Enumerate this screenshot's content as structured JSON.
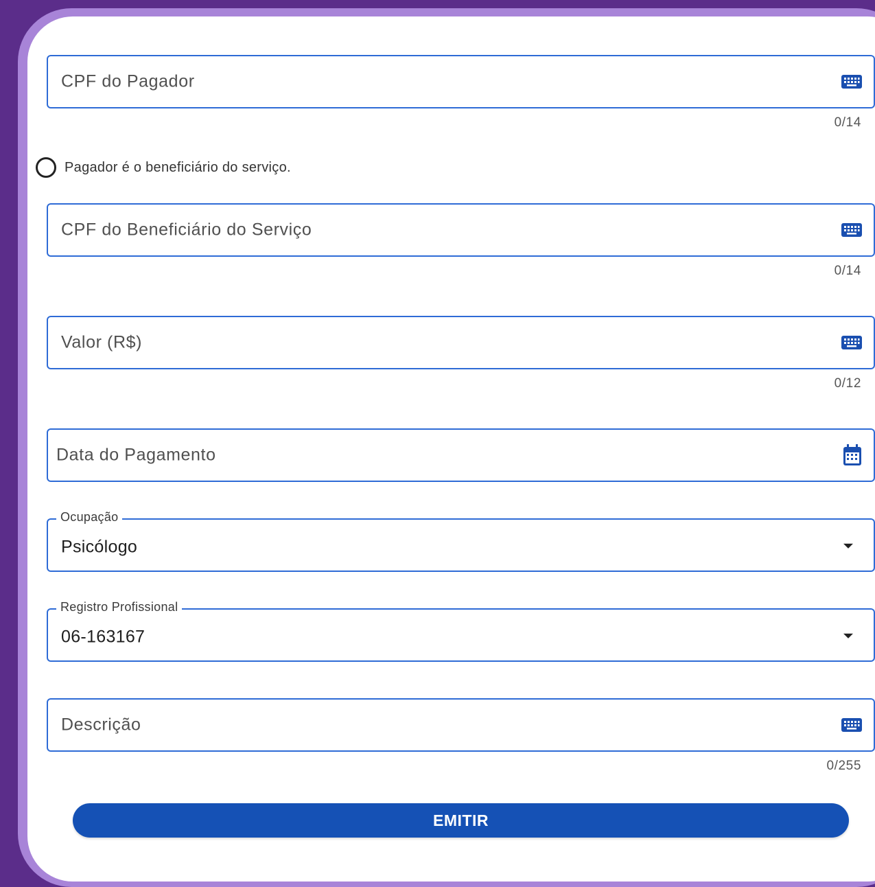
{
  "form": {
    "cpf_pagador": {
      "placeholder": "CPF do Pagador",
      "counter": "0/14",
      "icon": "keyboard-icon"
    },
    "radio_pagador_beneficiario": {
      "label": "Pagador é o beneficiário do serviço.",
      "checked": false
    },
    "cpf_beneficiario": {
      "placeholder": "CPF do Beneficiário do Serviço",
      "counter": "0/14",
      "icon": "keyboard-icon"
    },
    "valor": {
      "placeholder": "Valor (R$)",
      "counter": "0/12",
      "icon": "keyboard-icon"
    },
    "data_pagamento": {
      "placeholder": "Data do Pagamento",
      "icon": "calendar-icon"
    },
    "ocupacao": {
      "label": "Ocupação",
      "value": "Psicólogo",
      "icon": "dropdown-caret-icon"
    },
    "registro_profissional": {
      "label": "Registro Profissional",
      "value": "06-163167",
      "icon": "dropdown-caret-icon"
    },
    "descricao": {
      "placeholder": "Descrição",
      "counter": "0/255",
      "icon": "keyboard-icon"
    },
    "submit_label": "EMITIR"
  },
  "colors": {
    "background": "#5b2d8a",
    "frame": "#a884d8",
    "accent": "#1551b5",
    "field_border": "#2e6bd6"
  }
}
